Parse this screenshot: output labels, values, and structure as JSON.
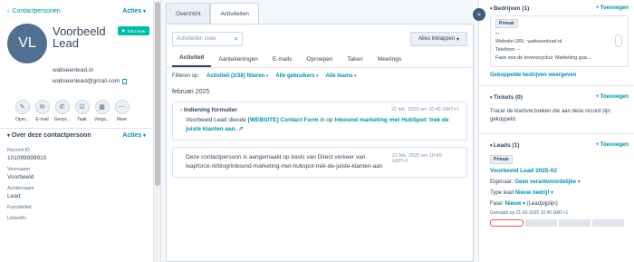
{
  "left": {
    "back_label": "Contactpersonen",
    "actions_label": "Acties",
    "avatar_initials": "VL",
    "name": "Voorbeeld Lead",
    "start_label": "Start Now",
    "website": "watiseenlead.nl",
    "email": "watiseenlead@gmail.com",
    "quick_actions": [
      {
        "icon": "note-icon",
        "label": "Opm...",
        "glyph": "✎"
      },
      {
        "icon": "email-icon",
        "label": "E-mail",
        "glyph": "✉"
      },
      {
        "icon": "call-icon",
        "label": "Gespr...",
        "glyph": "✆"
      },
      {
        "icon": "task-icon",
        "label": "Taak",
        "glyph": "☑"
      },
      {
        "icon": "meeting-icon",
        "label": "Verga...",
        "glyph": "▦"
      },
      {
        "icon": "more-icon",
        "label": "Meer",
        "glyph": "⋯"
      }
    ],
    "about_title": "Over deze contactpersoon",
    "about_actions": "Acties",
    "props": [
      {
        "key": "Record-ID",
        "value": "101099999910"
      },
      {
        "key": "Voornaam",
        "value": "Voorbeeld"
      },
      {
        "key": "Achternaam",
        "value": "Lead"
      },
      {
        "key": "Functietitel",
        "value": ""
      },
      {
        "key": "LinkedIn",
        "value": ""
      }
    ]
  },
  "mid": {
    "top_tabs": [
      "Overzicht",
      "Activiteiten"
    ],
    "search_placeholder": "Activiteiten zoek",
    "collapse_label": "Alles inklappen",
    "collapse_caret": "▾",
    "sub_tabs": [
      "Activiteit",
      "Aantekeningen",
      "E-mails",
      "Oproepen",
      "Taken",
      "Meetings"
    ],
    "filter_label": "Filteren op:",
    "filters": [
      "Activiteit (2/38) filteren",
      "Alle gebruikers",
      "Alle teams"
    ],
    "month": "februari 2025",
    "activity1": {
      "title": "Indiening formulier",
      "date": "21 feb. 2025 om 10:45 GMT+1",
      "text_pre": "Voorbeeld Lead diende ",
      "form_link": "[WEBSITE] Contact Form",
      "text_mid": " in op ",
      "page_link": "Inbound marketing met HubSpot: trek de juiste klanten aan.",
      "ext_icon": "↗"
    },
    "activity2": {
      "date": "21 feb. 2025 om 10:45 GMT+1",
      "text": "Deze contactpersoon is aangemaakt op basis van Direct verkeer van leapforce.nl/blog/inbound-marketing-met-hubspot-trek-de-juiste-klanten-aan"
    }
  },
  "right": {
    "expand_glyph": "»",
    "companies": {
      "title": "Bedrijven (1)",
      "add": "Toevoegen",
      "badge": "Primair",
      "dash": "--",
      "website": "Website URL:  watiseenlead.nl",
      "phone": "Telefoon:  --",
      "stage": "Fase van de levenscyclus:  Marketing gua...",
      "view_link": "Gekoppelde bedrijven weergeven"
    },
    "tickets": {
      "title": "Tickets (0)",
      "add": "Toevoegen",
      "text": "Tracer de klantverzoeken die aan deze record zijn gekoppeld."
    },
    "leads": {
      "title": "Leads (1)",
      "add": "Toevoegen",
      "badge": "Primair",
      "lead_name": "Voorbeeld Lead 2025-02",
      "owner_label": "Eigenaar:",
      "owner_value": "Geen verantwoordelijke",
      "type_label": "Type lead",
      "type_value": "Nieuw bedrijf",
      "phase_label": "Fase:",
      "phase_value": "Nieuw",
      "phase_suffix": "(Leadpijplijn)",
      "created": "Gemaakt op 21-02-2025 10:45 GMT+1"
    }
  }
}
